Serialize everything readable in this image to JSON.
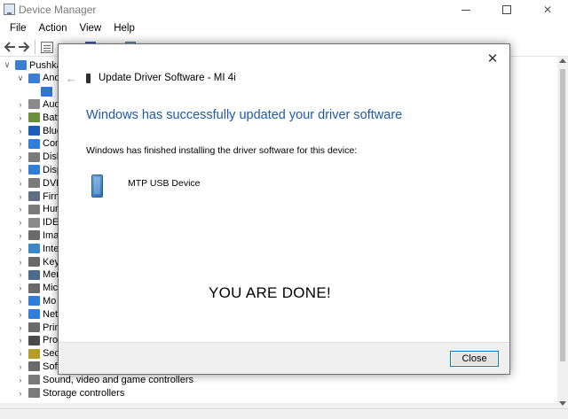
{
  "device_manager": {
    "title": "Device Manager",
    "menu": [
      "File",
      "Action",
      "View",
      "Help"
    ],
    "tree": {
      "root": "Pushka",
      "items": [
        {
          "label": "And",
          "icon": "phone-icon",
          "color": "#3b7fd0",
          "expanded": true
        },
        {
          "label": "",
          "icon": "phone-device-icon",
          "color": "#2f78c9",
          "child": true
        },
        {
          "label": "Aud",
          "icon": "speaker-icon",
          "color": "#8a8a8a"
        },
        {
          "label": "Batt",
          "icon": "battery-icon",
          "color": "#6b8e3a"
        },
        {
          "label": "Blue",
          "icon": "bluetooth-icon",
          "color": "#1b5fb8"
        },
        {
          "label": "Com",
          "icon": "computer-icon",
          "color": "#2f7fd6"
        },
        {
          "label": "Disk",
          "icon": "disk-icon",
          "color": "#7a7a7a"
        },
        {
          "label": "Disp",
          "icon": "display-icon",
          "color": "#2f7fd6"
        },
        {
          "label": "DVD",
          "icon": "dvd-icon",
          "color": "#7a7a7a"
        },
        {
          "label": "Firm",
          "icon": "firmware-icon",
          "color": "#5f6f80"
        },
        {
          "label": "Hum",
          "icon": "hid-icon",
          "color": "#7a7a7a"
        },
        {
          "label": "IDE",
          "icon": "ide-icon",
          "color": "#8a8a8a"
        },
        {
          "label": "Ima",
          "icon": "camera-icon",
          "color": "#6a6a6a"
        },
        {
          "label": "Inte",
          "icon": "interface-icon",
          "color": "#3a88c8"
        },
        {
          "label": "Key",
          "icon": "keyboard-icon",
          "color": "#6a6a6a"
        },
        {
          "label": "Mer",
          "icon": "memory-icon",
          "color": "#4a6b8a"
        },
        {
          "label": "Mic",
          "icon": "mouse-icon",
          "color": "#6a6a6a"
        },
        {
          "label": "Mo",
          "icon": "monitor-icon",
          "color": "#2f7fd6"
        },
        {
          "label": "Net",
          "icon": "network-icon",
          "color": "#2f7fd6"
        },
        {
          "label": "Prin",
          "icon": "printer-icon",
          "color": "#6a6a6a"
        },
        {
          "label": "Pro",
          "icon": "processor-icon",
          "color": "#4a4a4a"
        },
        {
          "label": "Sec",
          "icon": "security-icon",
          "color": "#b59b2a"
        },
        {
          "label": "Soft",
          "icon": "software-icon",
          "color": "#6a6a6a"
        },
        {
          "label": "Sound, video and game controllers",
          "icon": "sound-icon",
          "color": "#7a7a7a"
        },
        {
          "label": "Storage controllers",
          "icon": "storage-icon",
          "color": "#7a7a7a"
        }
      ]
    }
  },
  "dialog": {
    "header_title": "Update Driver Software - MI 4i",
    "heading": "Windows has successfully updated your driver software",
    "info": "Windows has finished installing the driver software for this device:",
    "device_name": "MTP USB Device",
    "annotation": "YOU ARE DONE!",
    "close_button": "Close",
    "heading_color": "#1f5aa6"
  }
}
